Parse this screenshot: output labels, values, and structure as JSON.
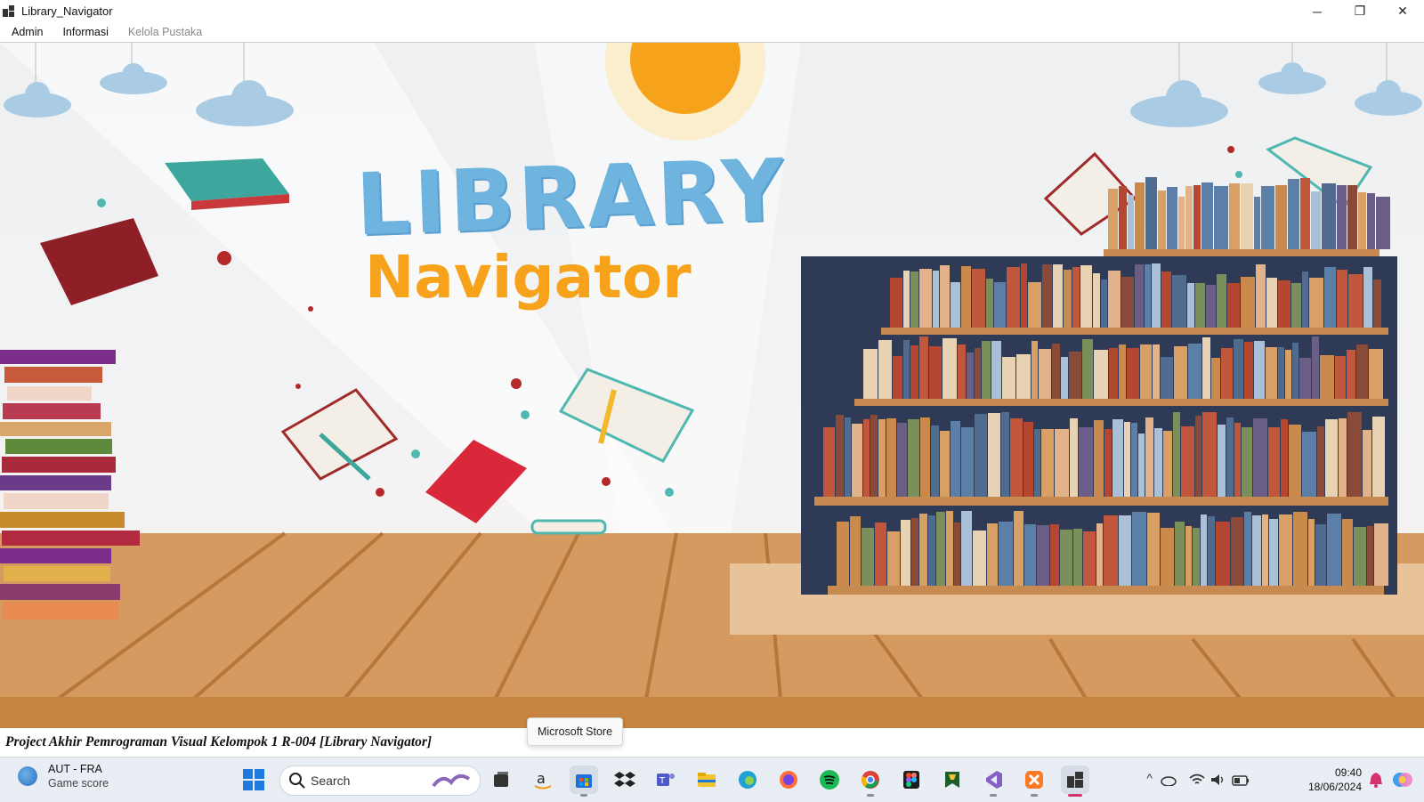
{
  "window": {
    "title": "Library_Navigator",
    "controls": {
      "minimize": "─",
      "restore": "❐",
      "close": "✕"
    }
  },
  "menu": [
    "Admin",
    "Informasi",
    "Kelola Pustaka"
  ],
  "banner": {
    "title_main": "LIBRARY",
    "title_sub": "Navigator",
    "colors": {
      "main": "#6fb3df",
      "sub": "#f7a21b",
      "floor": "#d49a5f",
      "sun": "#f6a21a"
    }
  },
  "status": {
    "text": "Project Akhir Pemrograman Visual Kelompok 1 R-004 [Library Navigator]"
  },
  "tooltip": {
    "text": "Microsoft Store"
  },
  "taskbar": {
    "weather": {
      "title": "AUT - FRA",
      "subtitle": "Game score"
    },
    "search": {
      "label": "Search"
    },
    "apps": [
      "start-icon",
      "search",
      "task-view-icon",
      "amazon-icon",
      "microsoft-store-icon",
      "dropbox-icon",
      "teams-icon",
      "file-explorer-icon",
      "edge-icon",
      "firefox-icon",
      "spotify-icon",
      "chrome-icon",
      "figma-icon",
      "bookmark-app-icon",
      "visual-studio-icon",
      "xampp-icon",
      "library-navigator-icon"
    ],
    "clock": {
      "time": "09:40",
      "date": "18/06/2024"
    }
  }
}
